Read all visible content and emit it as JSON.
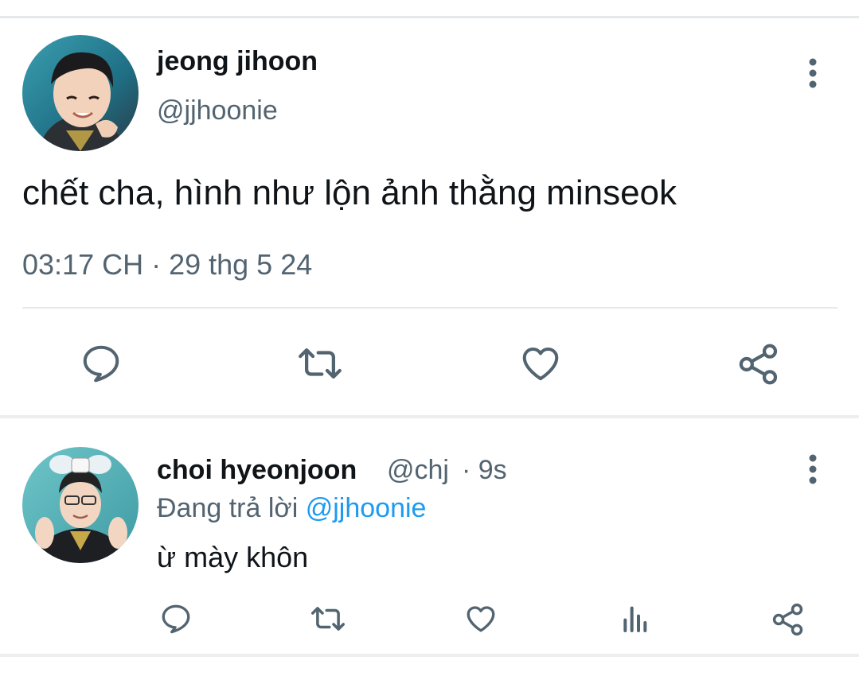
{
  "main_tweet": {
    "display_name": "jeong jihoon",
    "handle": "@jjhoonie",
    "text": "chết cha, hình như lộn ảnh thằng minseok",
    "timestamp": "03:17 CH · 29 thg 5 24",
    "more_icon": "more-vertical-icon",
    "actions": [
      "reply-icon",
      "retweet-icon",
      "like-icon",
      "share-icon"
    ]
  },
  "reply_tweet": {
    "display_name": "choi hyeonjoon",
    "handle": "@chj",
    "age": "· 9s",
    "replying_prefix": "Đang trả lời",
    "replying_to": "@jjhoonie",
    "text": "ừ mày khôn",
    "more_icon": "more-vertical-icon",
    "actions": [
      "reply-icon",
      "retweet-icon",
      "like-icon",
      "analytics-icon",
      "share-icon"
    ]
  },
  "colors": {
    "text_primary": "#0f1419",
    "text_secondary": "#536471",
    "link": "#1d9bf0",
    "icon": "#536471",
    "divider": "#e6e9ec"
  }
}
